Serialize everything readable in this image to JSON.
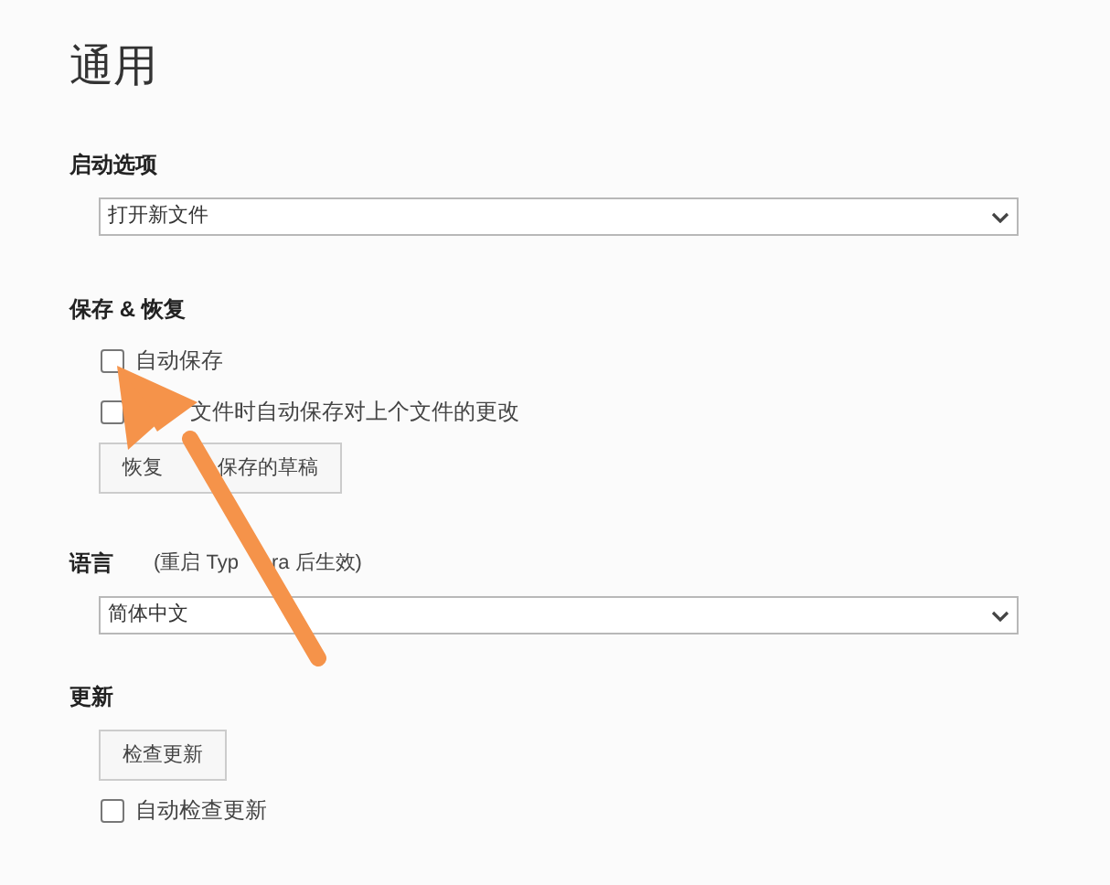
{
  "title": "通用",
  "sections": [
    {
      "kind": "select",
      "label": "启动选项",
      "value": "打开新文件"
    },
    {
      "kind": "restore",
      "label": "保存 & 恢复",
      "checkboxes": [
        {
          "parts": [
            "自动保存"
          ],
          "checked": false
        },
        {
          "parts": [
            "文件时自动保存对上个文件的更改"
          ],
          "checked": false
        }
      ],
      "button_parts": [
        "恢复",
        "保存的草稿"
      ]
    },
    {
      "kind": "language",
      "label": "语言",
      "note_parts": [
        "(重启 Typ",
        "ra 后生效)"
      ],
      "value": "简体中文"
    },
    {
      "kind": "update",
      "label": "更新",
      "button": "检查更新",
      "checkboxes": [
        {
          "parts": [
            "自动检查更新"
          ],
          "checked": false
        }
      ]
    }
  ]
}
